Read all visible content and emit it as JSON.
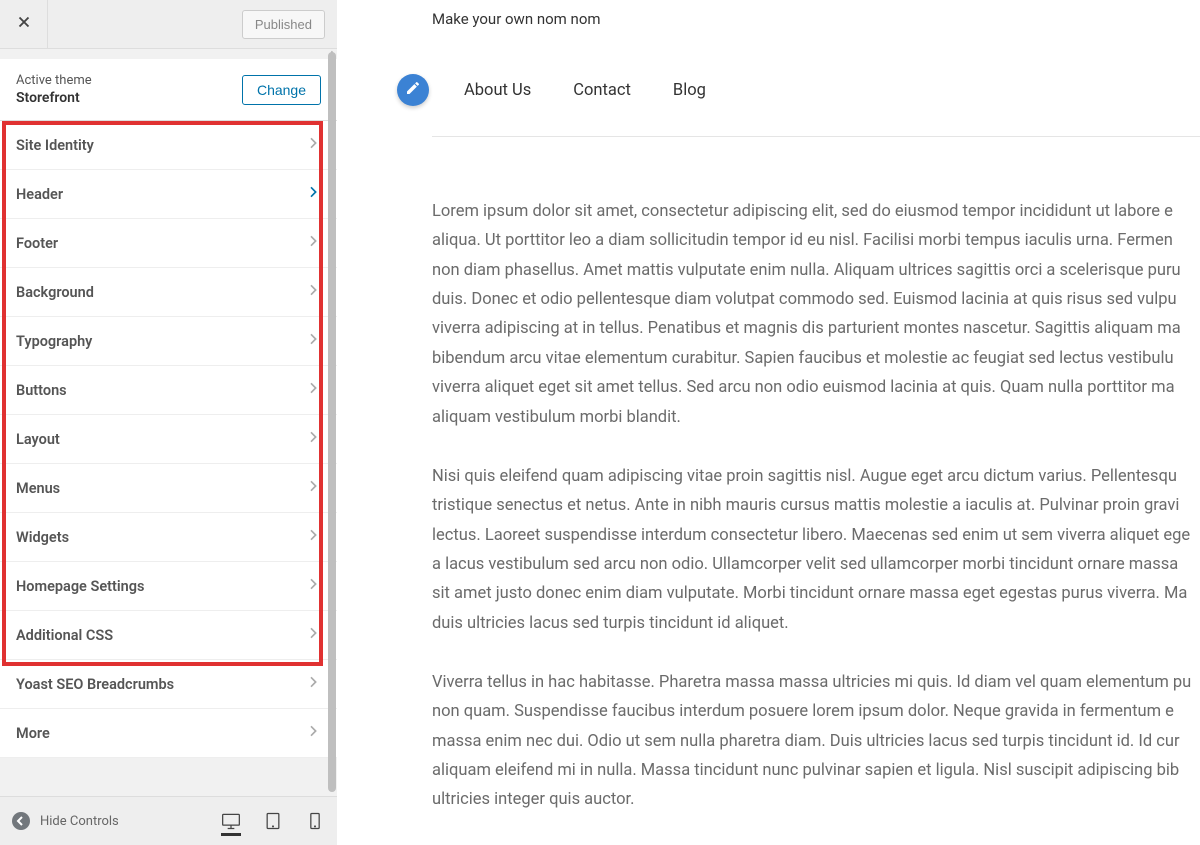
{
  "topbar": {
    "published_label": "Published"
  },
  "theme": {
    "active_label": "Active theme",
    "name": "Storefront",
    "change_label": "Change"
  },
  "panels": [
    {
      "label": "Site Identity",
      "active": false
    },
    {
      "label": "Header",
      "active": true
    },
    {
      "label": "Footer",
      "active": false
    },
    {
      "label": "Background",
      "active": false
    },
    {
      "label": "Typography",
      "active": false
    },
    {
      "label": "Buttons",
      "active": false
    },
    {
      "label": "Layout",
      "active": false
    },
    {
      "label": "Menus",
      "active": false
    },
    {
      "label": "Widgets",
      "active": false
    },
    {
      "label": "Homepage Settings",
      "active": false
    },
    {
      "label": "Additional CSS",
      "active": false
    },
    {
      "label": "Yoast SEO Breadcrumbs",
      "active": false
    },
    {
      "label": "More",
      "active": false
    }
  ],
  "footer": {
    "hide_label": "Hide Controls"
  },
  "preview": {
    "tagline": "Make your own nom nom",
    "nav": [
      "About Us",
      "Contact",
      "Blog"
    ],
    "paragraphs": [
      "Lorem ipsum dolor sit amet, consectetur adipiscing elit, sed do eiusmod tempor incididunt ut labore e aliqua. Ut porttitor leo a diam sollicitudin tempor id eu nisl. Facilisi morbi tempus iaculis urna. Fermen non diam phasellus. Amet mattis vulputate enim nulla. Aliquam ultrices sagittis orci a scelerisque puru duis. Donec et odio pellentesque diam volutpat commodo sed. Euismod lacinia at quis risus sed vulpu viverra adipiscing at in tellus. Penatibus et magnis dis parturient montes nascetur. Sagittis aliquam ma bibendum arcu vitae elementum curabitur. Sapien faucibus et molestie ac feugiat sed lectus vestibulu viverra aliquet eget sit amet tellus. Sed arcu non odio euismod lacinia at quis. Quam nulla porttitor ma aliquam vestibulum morbi blandit.",
      "Nisi quis eleifend quam adipiscing vitae proin sagittis nisl. Augue eget arcu dictum varius. Pellentesqu tristique senectus et netus. Ante in nibh mauris cursus mattis molestie a iaculis at. Pulvinar proin gravi lectus. Laoreet suspendisse interdum consectetur libero. Maecenas sed enim ut sem viverra aliquet ege a lacus vestibulum sed arcu non odio. Ullamcorper velit sed ullamcorper morbi tincidunt ornare massa sit amet justo donec enim diam vulputate. Morbi tincidunt ornare massa eget egestas purus viverra. Ma duis ultricies lacus sed turpis tincidunt id aliquet.",
      "Viverra tellus in hac habitasse. Pharetra massa massa ultricies mi quis. Id diam vel quam elementum pu non quam. Suspendisse faucibus interdum posuere lorem ipsum dolor. Neque gravida in fermentum e massa enim nec dui. Odio ut sem nulla pharetra diam. Duis ultricies lacus sed turpis tincidunt id. Id cur aliquam eleifend mi in nulla. Massa tincidunt nunc pulvinar sapien et ligula. Nisl suscipit adipiscing bib ultricies integer quis auctor."
    ]
  }
}
